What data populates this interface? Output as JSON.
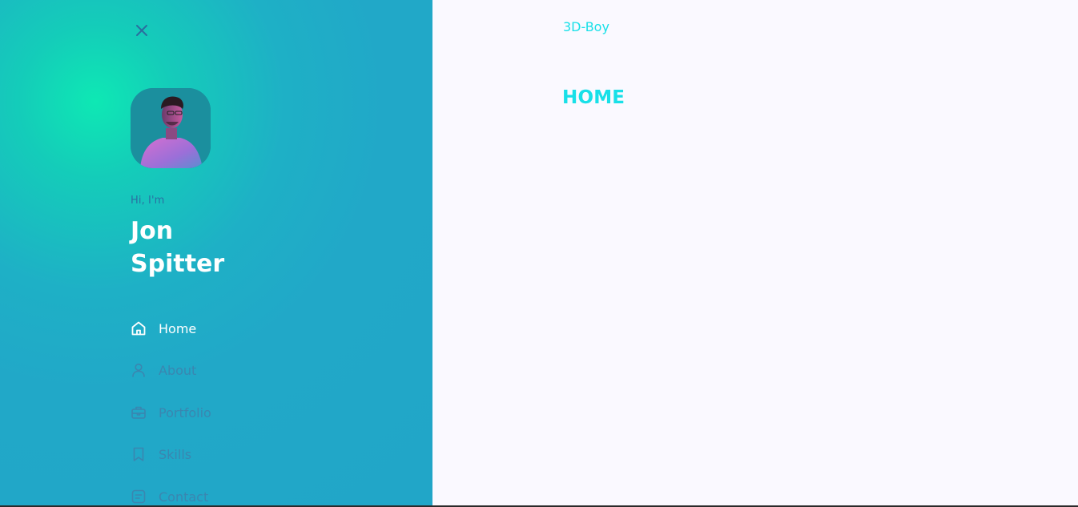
{
  "sidebar": {
    "greeting": "Hi, I'm",
    "name_first": "Jon",
    "name_last": "Spitter",
    "nav": [
      {
        "label": "Home",
        "icon": "home-icon",
        "active": true
      },
      {
        "label": "About",
        "icon": "user-icon",
        "active": false
      },
      {
        "label": "Portfolio",
        "icon": "briefcase-icon",
        "active": false
      },
      {
        "label": "Skills",
        "icon": "bookmark-icon",
        "active": false
      },
      {
        "label": "Contact",
        "icon": "message-icon",
        "active": false
      }
    ]
  },
  "main": {
    "brand": "3D-Boy",
    "heading": "HOME"
  },
  "colors": {
    "accent": "#18e0e8",
    "sidebar_bg": "#21a6c8",
    "sidebar_glow": "#0ee8b4",
    "inactive_nav": "#3a86b0",
    "main_bg": "#faf9ff"
  }
}
